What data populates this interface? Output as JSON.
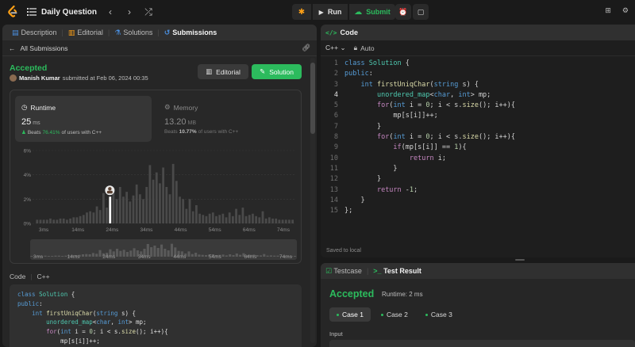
{
  "topbar": {
    "problem_title": "Daily Question",
    "run_label": "Run",
    "submit_label": "Submit"
  },
  "left": {
    "tabs": [
      {
        "label": "Description"
      },
      {
        "label": "Editorial"
      },
      {
        "label": "Solutions"
      },
      {
        "label": "Submissions"
      }
    ],
    "all_submissions": "All Submissions",
    "status": "Accepted",
    "user": "Manish Kumar",
    "submitted_text": "submitted at Feb 06, 2024 00:35",
    "editorial_btn": "Editorial",
    "solution_btn": "Solution",
    "runtime": {
      "title": "Runtime",
      "value": "25",
      "unit": "ms",
      "beats_prefix": "Beats",
      "beats_pct": "76.41%",
      "beats_suffix": "of users with C++"
    },
    "memory": {
      "title": "Memory",
      "value": "13.20",
      "unit": "MB",
      "beats_prefix": "Beats",
      "beats_pct": "10.77%",
      "beats_suffix": "of users with C++"
    },
    "code_label": "Code",
    "code_lang": "C++",
    "code_preview": [
      "class Solution {",
      "public:",
      "    int firstUniqChar(string s) {",
      "        unordered_map<char, int> mp;",
      "        for(int i = 0; i < s.size(); i++){",
      "            mp[s[i]]++;"
    ]
  },
  "chart_data": {
    "type": "bar",
    "title": "",
    "xlabel": "",
    "ylabel": "",
    "ylim": [
      0,
      6
    ],
    "y_ticks": [
      "0%",
      "2%",
      "4%",
      "6%"
    ],
    "x_tick_labels": [
      "3ms",
      "14ms",
      "24ms",
      "34ms",
      "44ms",
      "54ms",
      "64ms",
      "74ms"
    ],
    "selected_category": "25ms",
    "values": [
      0.3,
      0.3,
      0.3,
      0.3,
      0.4,
      0.3,
      0.3,
      0.4,
      0.4,
      0.3,
      0.4,
      0.5,
      0.5,
      0.6,
      0.7,
      0.9,
      1.0,
      0.9,
      1.4,
      1.1,
      2.5,
      1.3,
      1.5,
      2.8,
      2.0,
      3.0,
      2.2,
      2.6,
      1.8,
      2.3,
      3.2,
      2.4,
      2.0,
      3.0,
      4.8,
      3.6,
      4.2,
      3.3,
      4.6,
      3.0,
      2.4,
      4.9,
      3.5,
      2.2,
      2.0,
      1.2,
      2.0,
      1.0,
      1.5,
      0.8,
      0.7,
      0.6,
      0.8,
      0.9,
      0.6,
      0.7,
      0.8,
      0.5,
      0.9,
      0.6,
      1.2,
      0.7,
      1.3,
      0.6,
      0.7,
      0.8,
      0.6,
      0.5,
      1.0,
      0.4,
      0.5,
      0.4,
      0.4,
      0.3,
      0.3,
      0.3,
      0.3,
      0.3
    ],
    "selected_value": 2.2
  },
  "editor": {
    "title": "Code",
    "language": "C++",
    "auto_label": "Auto",
    "saved": "Saved to local",
    "current_line": 4,
    "lines": [
      "class Solution {",
      "public:",
      "    int firstUniqChar(string s) {",
      "        unordered_map<char, int> mp;",
      "        for(int i = 0; i < s.size(); i++){",
      "            mp[s[i]]++;",
      "        }",
      "        for(int i = 0; i < s.size(); i++){",
      "            if(mp[s[i]] == 1){",
      "                return i;",
      "            }",
      "        }",
      "        return -1;",
      "    }",
      "};"
    ]
  },
  "test": {
    "tab_testcase": "Testcase",
    "tab_result": "Test Result",
    "status": "Accepted",
    "runtime": "Runtime: 2 ms",
    "cases": [
      "Case 1",
      "Case 2",
      "Case 3"
    ],
    "input_label": "Input"
  },
  "colors": {
    "accent_green": "#2cbb5d",
    "bg": "#1a1a1a",
    "panel": "#262626"
  }
}
